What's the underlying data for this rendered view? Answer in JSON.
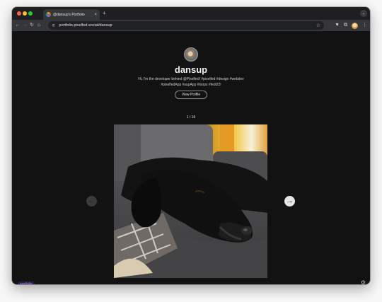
{
  "browser": {
    "tab_title": "@dansup's Portfolio",
    "tab_close": "×",
    "new_tab": "+",
    "menu_chevron": "⌄",
    "url": "portfolio.pixelfed.social/dansup",
    "back": "←",
    "forward": "→",
    "reload": "↻",
    "home": "⌂",
    "site_info": "⚟",
    "bookmark": "☆",
    "filter": "▼",
    "extensions": "⧉",
    "more": "⋮"
  },
  "profile": {
    "username": "dansup",
    "bio_line1": "Hi, I'm the developer behind @Pixelfed! #pixelfed #design #webdev",
    "bio_line2": "#pixelfedApp #supApp #loops #fedi22!",
    "view_button": "View Profile"
  },
  "gallery": {
    "counter": "1 / 16",
    "prev_arrow": "←",
    "next_arrow": "→"
  },
  "footer": {
    "logo": "portfolio",
    "settings_glyph": "⚙"
  }
}
